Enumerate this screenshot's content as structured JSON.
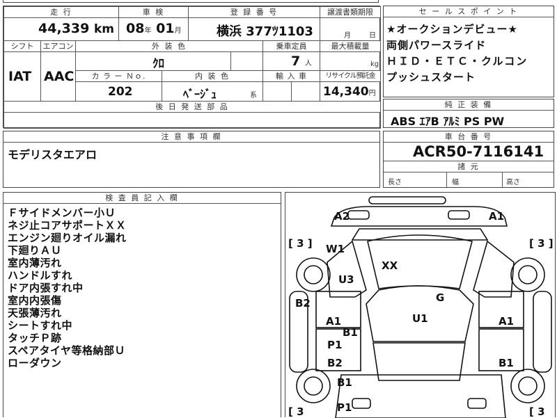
{
  "mileage": {
    "header": "走 行",
    "value": "44,339",
    "unit": "km"
  },
  "inspection": {
    "header": "車 検",
    "year": "08",
    "year_unit": "年",
    "month": "01",
    "month_unit": "月"
  },
  "registration": {
    "header": "登 録 番 号",
    "value": "横浜 377ﾂ1103"
  },
  "transfer": {
    "header": "譲渡書類期限",
    "month_unit": "月",
    "day_unit": "日"
  },
  "shift": {
    "header": "シフト",
    "value": "IAT"
  },
  "ac": {
    "header": "エアコン",
    "value": "AAC"
  },
  "exterior_color": {
    "header": "外 装 色",
    "value": "ｸﾛ"
  },
  "capacity": {
    "header": "乗車定員",
    "value": "7",
    "unit": "人"
  },
  "max_load": {
    "header": "最大積載量",
    "unit": "kg"
  },
  "color_no": {
    "header": "カ ラ ー Ｎｏ.",
    "value": "202"
  },
  "interior_color": {
    "header": "内 装 色",
    "value": "ﾍﾞｰｼﾞｭ",
    "suffix": "系"
  },
  "import": {
    "header": "輸 入 車"
  },
  "recycle": {
    "header": "リサイクル預託金",
    "value": "14,340",
    "unit": "円"
  },
  "later_parts": {
    "header": "後 日 発 送 部 品"
  },
  "sales_points": {
    "header": "セ ー ル ス ポ イ ン ト",
    "lines": [
      "★オークションデビュー★",
      "両側パワースライド",
      "ＨＩＤ・ＥＴＣ・クルコン",
      "プッシュスタート"
    ]
  },
  "equipment": {
    "header": "純 正 装 備",
    "value": "ABS ｴｱB ｱﾙﾐ PS PW"
  },
  "notes": {
    "header": "注 意 事 項 欄",
    "value": "モデリスタエアロ"
  },
  "chassis": {
    "header": "車 台 番 号",
    "value": "ACR50-7116141"
  },
  "specs": {
    "header": "諸 元",
    "length": "長さ",
    "width": "幅",
    "height": "高さ"
  },
  "inspector": {
    "header": "検 査 員 記 入 欄",
    "lines": [
      "Ｆサイドメンバー小Ｕ",
      "ネジ止コアサポートＸＸ",
      "エンジン廻りオイル漏れ",
      "下廻りＡＵ",
      "室内薄汚れ",
      "ハンドルすれ",
      "ドア内張すれ中",
      "室内内張傷",
      "天張薄汚れ",
      "シートすれ中",
      "タッチＰ跡",
      "スペアタイヤ等格納部Ｕ",
      "ローダウン"
    ]
  },
  "diagram": {
    "labels": {
      "a2": "A2",
      "a1_top": "A1",
      "t_left": "[ 3 ]",
      "t_right": "[ 3 ]",
      "w1": "W1",
      "xx": "XX",
      "u3": "U3",
      "b2_left": "B2",
      "g": "G",
      "u1": "U1",
      "a1_left": "A1",
      "a1_right": "A1",
      "b1_mid": "B1",
      "p1_left": "P1",
      "b2_left2": "B2",
      "b1_right": "B1",
      "b1_left": "B1",
      "p1_bottom": "P1",
      "t_bl": "[ 3",
      "t_br": "[ 3"
    }
  }
}
